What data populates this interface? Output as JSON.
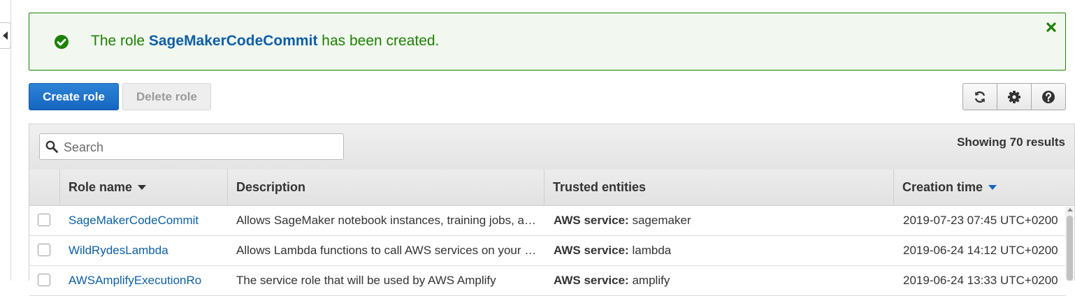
{
  "flash": {
    "prefix": "The role ",
    "role_name": "SageMakerCodeCommit",
    "suffix": " has been created.",
    "icons": [
      "check-circle-icon",
      "close-icon"
    ],
    "color": "#1d8102"
  },
  "toolbar": {
    "create_label": "Create role",
    "delete_label": "Delete role",
    "icons": [
      "refresh-icon",
      "gear-icon",
      "help-icon"
    ]
  },
  "search": {
    "placeholder": "Search"
  },
  "results_text": "Showing 70 results",
  "columns": {
    "role_name": "Role name",
    "description": "Description",
    "trusted": "Trusted entities",
    "created": "Creation time"
  },
  "rows": [
    {
      "name": "SageMakerCodeCommit",
      "description": "Allows SageMaker notebook instances, training jobs, and models to access AWS services on your behalf.",
      "trusted_label": "AWS service:",
      "trusted_value": "sagemaker",
      "created": "2019-07-23 07:45 UTC+0200"
    },
    {
      "name": "WildRydesLambda",
      "description": "Allows Lambda functions to call AWS services on your behalf.",
      "trusted_label": "AWS service:",
      "trusted_value": "lambda",
      "created": "2019-06-24 14:12 UTC+0200"
    },
    {
      "name": "AWSAmplifyExecutionRo",
      "description": "The service role that will be used by AWS Amplify",
      "trusted_label": "AWS service:",
      "trusted_value": "amplify",
      "created": "2019-06-24 13:33 UTC+0200"
    }
  ],
  "colors": {
    "link": "#0d5fa6",
    "primary": "#1565c0",
    "success": "#1d8102"
  }
}
